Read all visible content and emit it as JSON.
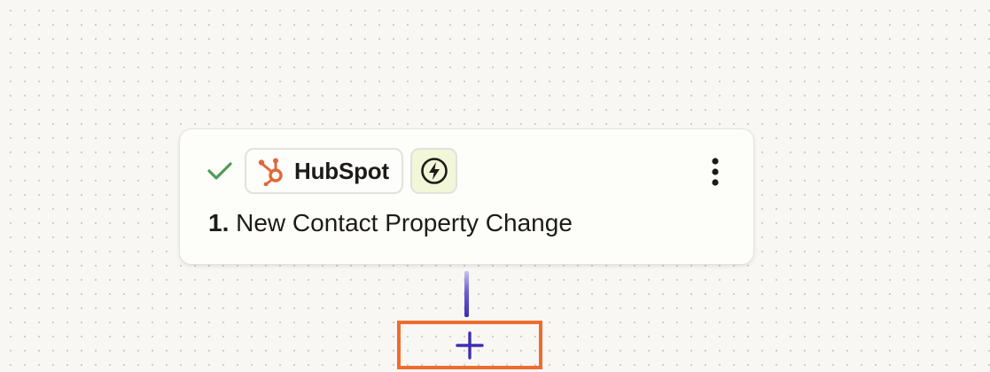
{
  "step": {
    "status_icon": "check-icon",
    "status_color": "#4f9b55",
    "app": {
      "name": "HubSpot",
      "icon": "hubspot-icon",
      "icon_color": "#e0683a"
    },
    "trigger_icon": "lightning-bolt-icon",
    "trigger_badge_color": "#f2f7d9",
    "menu_icon": "more-vertical-icon",
    "number": "1.",
    "title": "New Contact Property Change"
  },
  "connector": {
    "add_icon": "plus-icon",
    "accent_color": "#3d2fb0",
    "highlight_color": "#ef6c2f"
  }
}
